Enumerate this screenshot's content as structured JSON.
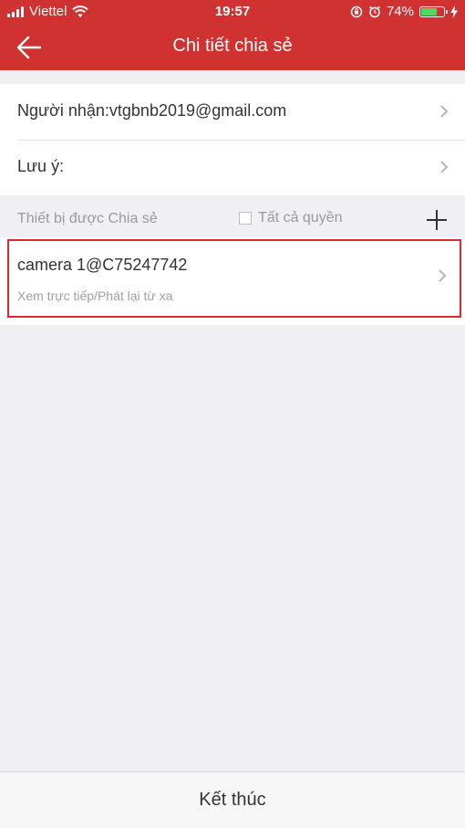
{
  "status_bar": {
    "carrier": "Viettel",
    "time": "19:57",
    "battery_percent": "74%",
    "battery_level": 0.74,
    "icons": [
      "signal-icon",
      "wifi-icon",
      "rotation-lock-icon",
      "alarm-icon",
      "battery-icon",
      "charging-icon"
    ]
  },
  "nav": {
    "title": "Chi tiết chia sẻ",
    "back_icon": "back-arrow-icon"
  },
  "recipient": {
    "label": "Người nhận:vtgbnb2019@gmail.com"
  },
  "note": {
    "label": "Lưu ý:"
  },
  "devices_section": {
    "label": "Thiết bị được Chia sẻ",
    "all_permissions_label": "Tất cả quyền",
    "all_permissions_checked": false,
    "add_icon": "plus-icon"
  },
  "devices": [
    {
      "name": "camera 1@C75247742",
      "permissions": "Xem trực tiếp/Phát lại từ xa"
    }
  ],
  "footer": {
    "finish_label": "Kết thúc"
  },
  "colors": {
    "header": "#d03131",
    "highlight_border": "#e0262e",
    "background": "#efeff4",
    "battery_fill": "#4cd964"
  }
}
